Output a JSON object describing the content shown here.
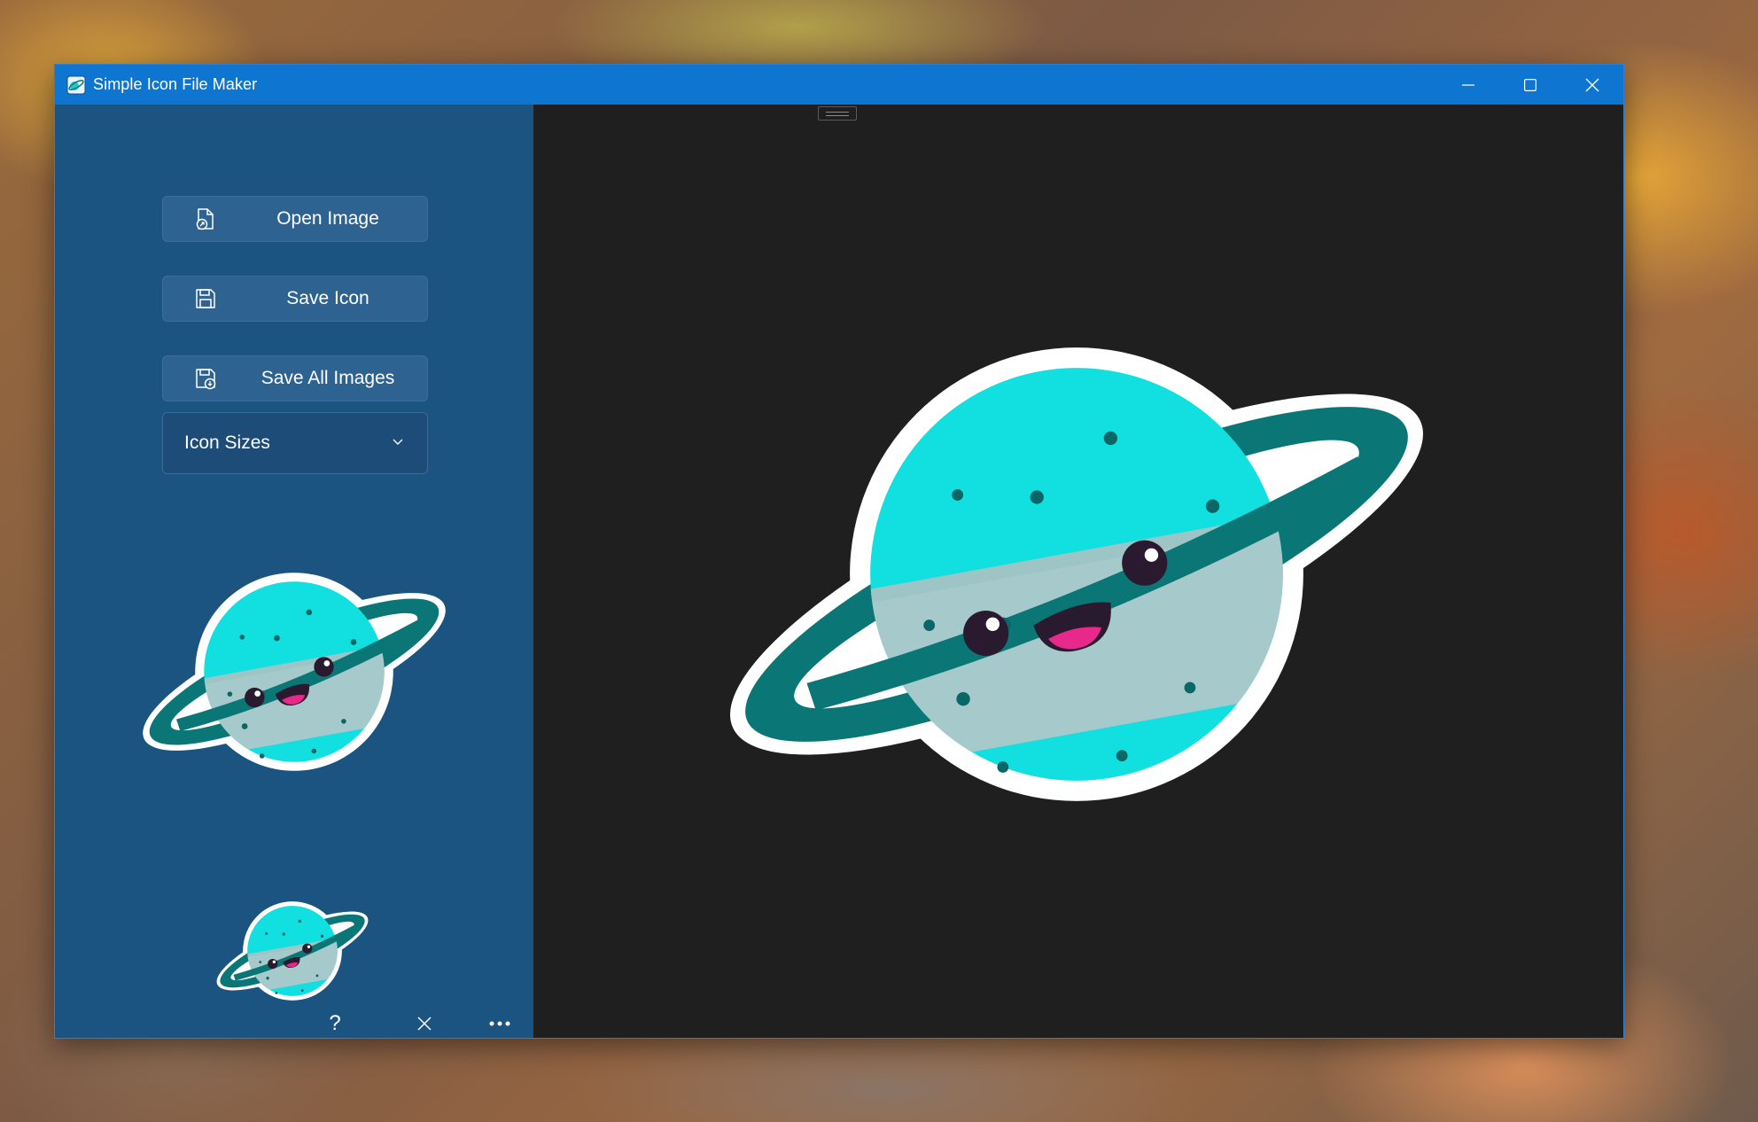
{
  "window": {
    "title": "Simple Icon File Maker",
    "caption_buttons": [
      "minimize-icon",
      "maximize-icon",
      "close-icon"
    ]
  },
  "sidebar": {
    "buttons": [
      {
        "label": "Open Image",
        "icon": "open-file-icon"
      },
      {
        "label": "Save Icon",
        "icon": "save-icon"
      },
      {
        "label": "Save All Images",
        "icon": "save-all-icon"
      }
    ],
    "icon_sizes": {
      "label": "Icon Sizes"
    },
    "bottom_bar": {
      "help_label": "?",
      "icons": [
        "help-icon",
        "clear-icon",
        "more-options-icon"
      ]
    }
  },
  "colors": {
    "titlebar": "#0e75d0",
    "sidebar": "#1c5481",
    "canvas": "#1f1f1f",
    "planet_cyan": "#12dfe0",
    "planet_gray": "#a6cacb",
    "ring": "#0b7676"
  }
}
